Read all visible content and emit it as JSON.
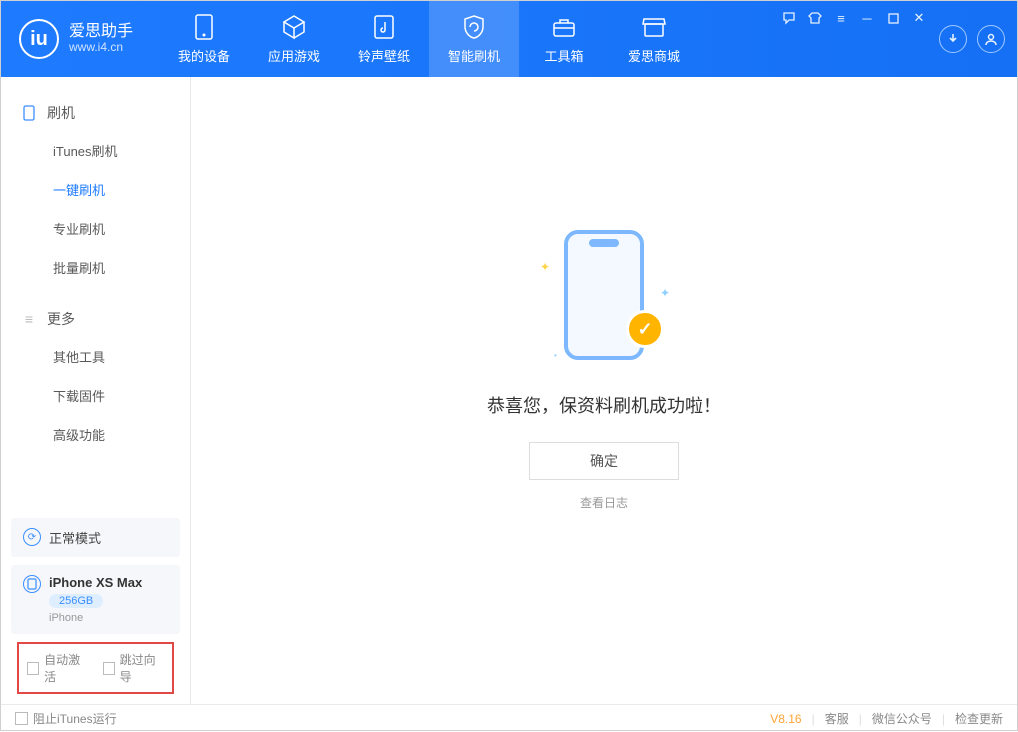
{
  "header": {
    "logo_title": "爱思助手",
    "logo_sub": "www.i4.cn",
    "tabs": [
      {
        "label": "我的设备"
      },
      {
        "label": "应用游戏"
      },
      {
        "label": "铃声壁纸"
      },
      {
        "label": "智能刷机"
      },
      {
        "label": "工具箱"
      },
      {
        "label": "爱思商城"
      }
    ]
  },
  "sidebar": {
    "section1_title": "刷机",
    "items1": [
      {
        "label": "iTunes刷机"
      },
      {
        "label": "一键刷机"
      },
      {
        "label": "专业刷机"
      },
      {
        "label": "批量刷机"
      }
    ],
    "section2_title": "更多",
    "items2": [
      {
        "label": "其他工具"
      },
      {
        "label": "下载固件"
      },
      {
        "label": "高级功能"
      }
    ],
    "status_mode": "正常模式",
    "device": {
      "name": "iPhone XS Max",
      "capacity": "256GB",
      "type": "iPhone"
    },
    "checkbox_auto_activate": "自动激活",
    "checkbox_skip_guide": "跳过向导"
  },
  "main": {
    "success_text": "恭喜您，保资料刷机成功啦！",
    "ok_button": "确定",
    "view_log": "查看日志"
  },
  "footer": {
    "block_itunes": "阻止iTunes运行",
    "version": "V8.16",
    "links": [
      "客服",
      "微信公众号",
      "检查更新"
    ]
  }
}
